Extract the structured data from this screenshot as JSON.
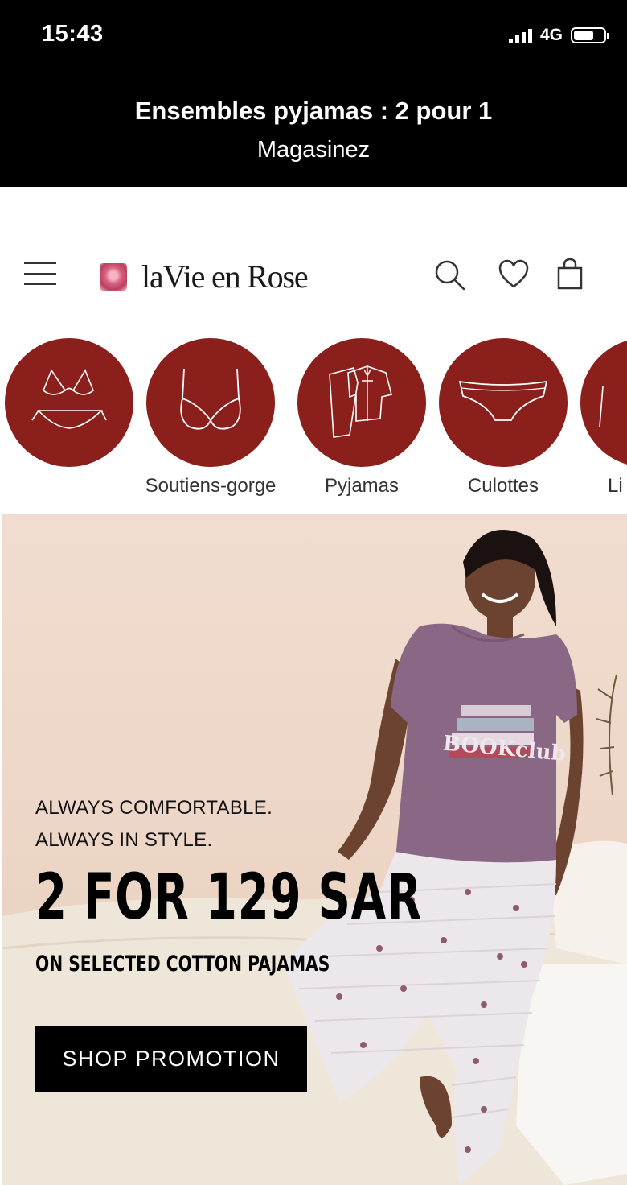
{
  "status_bar": {
    "time": "15:43",
    "network": "4G"
  },
  "promo": {
    "title": "Ensembles pyjamas : 2 pour 1",
    "link": "Magasinez"
  },
  "header": {
    "logo_text": "laVie en Rose",
    "icons": [
      "menu-icon",
      "search-icon",
      "heart-icon",
      "shopping-bag-icon"
    ]
  },
  "categories": [
    {
      "label": "",
      "icon": "bikini-icon"
    },
    {
      "label": "Soutiens-gorge",
      "icon": "bra-icon"
    },
    {
      "label": "Pyjamas",
      "icon": "pyjama-icon"
    },
    {
      "label": "Culottes",
      "icon": "panty-icon"
    },
    {
      "label": "Li",
      "icon": "lingerie-icon"
    }
  ],
  "hero": {
    "tagline_1": "ALWAYS COMFORTABLE.",
    "tagline_2": "ALWAYS IN STYLE.",
    "headline": "2 FOR 129 SAR",
    "subheadline": "ON SELECTED COTTON PAJAMAS",
    "cta": "SHOP PROMOTION",
    "shirt_text": "BOOKclub"
  },
  "colors": {
    "category_red": "#8b1f1c",
    "topbar": "#000000",
    "cta_bg": "#000000"
  }
}
